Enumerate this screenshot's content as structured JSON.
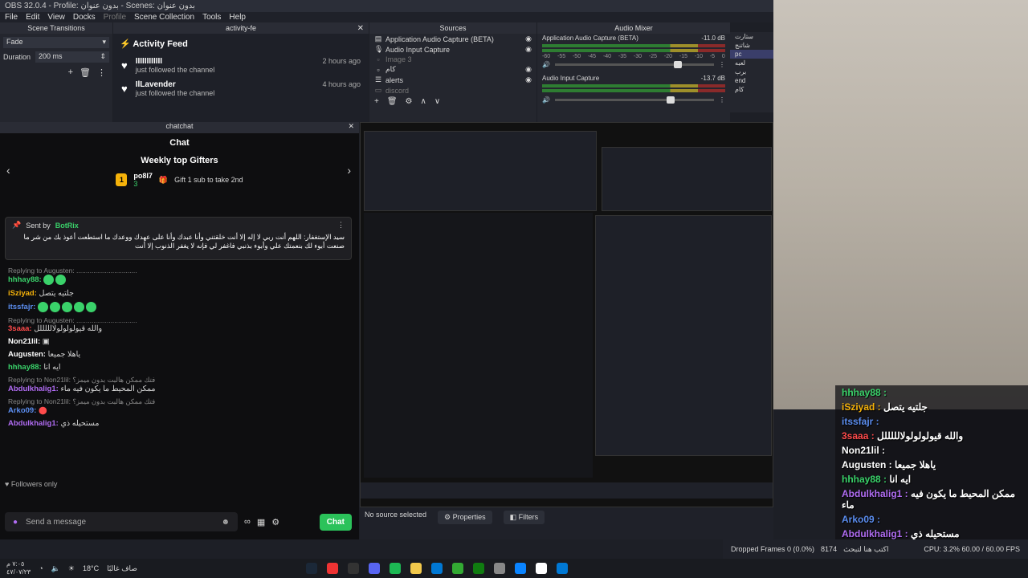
{
  "window": {
    "title": "OBS 32.0.4 - Profile: بدون عنوان - Scenes: بدون عنوان",
    "menu": [
      "File",
      "Edit",
      "View",
      "Docks",
      "Profile",
      "Scene Collection",
      "Tools",
      "Help"
    ]
  },
  "scene_transitions": {
    "title": "Scene Transitions",
    "transition": "Fade",
    "duration_label": "Duration",
    "duration_value": "200 ms"
  },
  "activity": {
    "dock_title": "activity-fe",
    "title": "Activity Feed",
    "items": [
      {
        "name": "IIIIIIIIIIII",
        "sub": "just followed the channel",
        "time": "2 hours ago"
      },
      {
        "name": "IlLavender",
        "sub": "just followed the channel",
        "time": "4 hours ago"
      }
    ]
  },
  "sources": {
    "title": "Sources",
    "items": [
      "Application Audio Capture (BETA)",
      "Audio Input Capture",
      "Image 3",
      "كام",
      "alerts",
      "discord"
    ]
  },
  "mixer": {
    "title": "Audio Mixer",
    "channels": [
      {
        "name": "Application Audio Capture (BETA)",
        "db": "-11.0 dB"
      },
      {
        "name": "Audio Input Capture",
        "db": "-13.7 dB"
      }
    ],
    "scale": [
      "-60",
      "-55",
      "-50",
      "-45",
      "-40",
      "-35",
      "-30",
      "-25",
      "-20",
      "-15",
      "-10",
      "-5",
      "0"
    ]
  },
  "scenes": [
    "ستارت",
    "شاتنج",
    "pc",
    "لعبه",
    "برب",
    "end",
    "كام"
  ],
  "chat": {
    "dock_title": "chatchat",
    "title": "Chat",
    "gifters_title": "Weekly top Gifters",
    "top_gifter": "po8I7",
    "top_gifter_count": "3",
    "gift_cta": "Gift 1 sub to take 2nd",
    "pinned_label": "Sent by",
    "pinned_user": "BotRix",
    "pinned_text": "سيد الإستغفار: اللهم أنت ربي لا إله إلا أنت خلقتني وأنا عبدك وأنا على عهدك ووعدك ما استطعت أعوذ بك من شر ما صنعت أبوء لك بنعمتك علي وأبوء بذنبي فاغفر لي فإنه لا يغفر الذنوب إلا أنت",
    "messages": [
      {
        "reply": "Replying to Augusten: ................................",
        "user": "hhhay88:",
        "text": "",
        "color": "#3ad26a"
      },
      {
        "reply": "",
        "user": "iSziyad:",
        "text": "جلتيه يتصل",
        "color": "#f5b20a"
      },
      {
        "reply": "",
        "user": "itssfajr:",
        "text": "",
        "color": "#5b8def"
      },
      {
        "reply": "Replying to Augusten: ................................",
        "user": "3saaa:",
        "text": "والله قيولولولولالللللل",
        "color": "#ff4b4b"
      },
      {
        "reply": "",
        "user": "Non21lil:",
        "text": "",
        "color": "#ffffff"
      },
      {
        "reply": "",
        "user": "Augusten:",
        "text": "ياهلا جميعا",
        "color": "#ffffff"
      },
      {
        "reply": "",
        "user": "hhhay88:",
        "text": "ايه انا",
        "color": "#3ad26a"
      },
      {
        "reply": "Replying to Non21lil: فتك ممكن هالبت بدون ميمز؟",
        "user": "Abdulkhalig1:",
        "text": "ممكن المحيط ما يكون فيه ماء",
        "color": "#b06cf2"
      },
      {
        "reply": "Replying to Non21lil: فتك ممكن هالبت بدون ميمز؟",
        "user": "Arko09:",
        "text": "",
        "color": "#5b8def"
      },
      {
        "reply": "",
        "user": "Abdulkhalig1:",
        "text": "مستحيله ذي",
        "color": "#b06cf2"
      }
    ],
    "followers_only": "Followers only",
    "input_placeholder": "Send a message",
    "chat_button": "Chat"
  },
  "status": {
    "no_source": "No source selected",
    "properties": "Properties",
    "filters": "Filters",
    "dropped_frames": "Dropped Frames 0 (0.0%)",
    "cpu": "CPU: 3.2% 60.00 / 60.00 FPS",
    "kbps": "8174"
  },
  "overlay": {
    "lines": [
      {
        "user": "hhhay88 :",
        "text": ""
      },
      {
        "user": "iSziyad :",
        "text": "جلتيه يتصل"
      },
      {
        "user": "itssfajr :",
        "text": ""
      },
      {
        "user": "3saaa :",
        "text": "والله قيولولولولالللللل"
      },
      {
        "user": "Non21lil :",
        "text": ""
      },
      {
        "user": "Augusten :",
        "text": "ياهلا جميعا"
      },
      {
        "user": "hhhay88 :",
        "text": "ايه انا"
      },
      {
        "user": "Abdulkhalig1 :",
        "text": "ممكن المحيط ما يكون فيه ماء"
      },
      {
        "user": "Arko09 :",
        "text": ""
      },
      {
        "user": "Abdulkhalig1 :",
        "text": "مستحيله ذي"
      }
    ],
    "input_hint": "اكتب هنا لتبحث"
  },
  "taskbar": {
    "weather": "18°C",
    "weather_text": "صاف غالبًا",
    "time": "٧:٠٥ م",
    "date": "٤٧/٠٧/٢٣"
  }
}
